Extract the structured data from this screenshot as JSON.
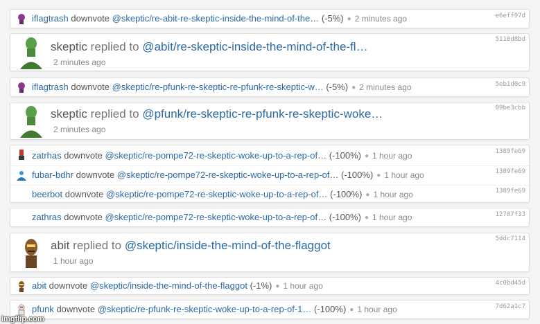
{
  "feed": [
    {
      "kind": "vote",
      "hash": "e6eff97d",
      "user": "iflagtrash",
      "verb": "downvote",
      "link": "@skeptic/re-abit-re-skeptic-inside-the-mind-of-the…",
      "pct": "(-5%)",
      "ago": "2 minutes ago",
      "avatar": "purple-figure"
    },
    {
      "kind": "reply",
      "hash": "5110d8bd",
      "user": "skeptic",
      "verb": "replied to",
      "link": "@abit/re-skeptic-inside-the-mind-of-the-fl…",
      "ago": "2 minutes ago",
      "avatar": "green-figure"
    },
    {
      "kind": "vote",
      "hash": "5eb1d0c9",
      "user": "iflagtrash",
      "verb": "downvote",
      "link": "@skeptic/re-pfunk-re-skeptic-re-pfunk-re-skeptic-w…",
      "pct": "(-5%)",
      "ago": "2 minutes ago",
      "avatar": "purple-figure"
    },
    {
      "kind": "reply",
      "hash": "09be3cbb",
      "user": "skeptic",
      "verb": "replied to",
      "link": "@pfunk/re-skeptic-re-pfunk-re-skeptic-woke…",
      "ago": "2 minutes ago",
      "avatar": "green-figure"
    },
    {
      "kind": "vote",
      "hash": "1389fe69",
      "user": "zatrhas",
      "verb": "downvote",
      "link": "@skeptic/re-pompe72-re-skeptic-woke-up-to-a-rep-of…",
      "pct": "(-100%)",
      "ago": "1 hour ago",
      "avatar": "red-figure"
    },
    {
      "kind": "vote",
      "hash": "1389fe69",
      "user": "fubar-bdhr",
      "verb": "downvote",
      "link": "@skeptic/re-pompe72-re-skeptic-woke-up-to-a-rep-of…",
      "pct": "(-100%)",
      "ago": "1 hour ago",
      "avatar": "blue-figure"
    },
    {
      "kind": "vote",
      "hash": "1389fe69",
      "user": "beerbot",
      "verb": "downvote",
      "link": "@skeptic/re-pompe72-re-skeptic-woke-up-to-a-rep-of…",
      "pct": "(-100%)",
      "ago": "1 hour ago",
      "avatar": "none"
    },
    {
      "kind": "vote",
      "hash": "12707f33",
      "user": "zathras",
      "verb": "downvote",
      "link": "@skeptic/re-pompe72-re-skeptic-woke-up-to-a-rep-of…",
      "pct": "(-100%)",
      "ago": "1 hour ago",
      "avatar": "none"
    },
    {
      "kind": "reply",
      "hash": "5ddc7114",
      "user": "abit",
      "verb": "replied to",
      "link": "@skeptic/inside-the-mind-of-the-flaggot",
      "ago": "1 hour ago",
      "avatar": "brown-figure"
    },
    {
      "kind": "vote",
      "hash": "4c0bd45d",
      "user": "abit",
      "verb": "downvote",
      "link": "@skeptic/inside-the-mind-of-the-flaggot",
      "pct": "(-1%)",
      "ago": "1 hour ago",
      "avatar": "brown-figure"
    },
    {
      "kind": "vote",
      "hash": "7d62a1c7",
      "user": "pfunk",
      "verb": "downvote",
      "link": "@skeptic/re-pfunk-re-skeptic-woke-up-to-a-rep-of-1…",
      "pct": "(-100%)",
      "ago": "1 hour ago",
      "avatar": "white-figure"
    }
  ],
  "watermark": "imgflip.com",
  "colors": {
    "link": "#2b6aa6",
    "background": "#f4f4f4",
    "card": "#ffffff"
  }
}
